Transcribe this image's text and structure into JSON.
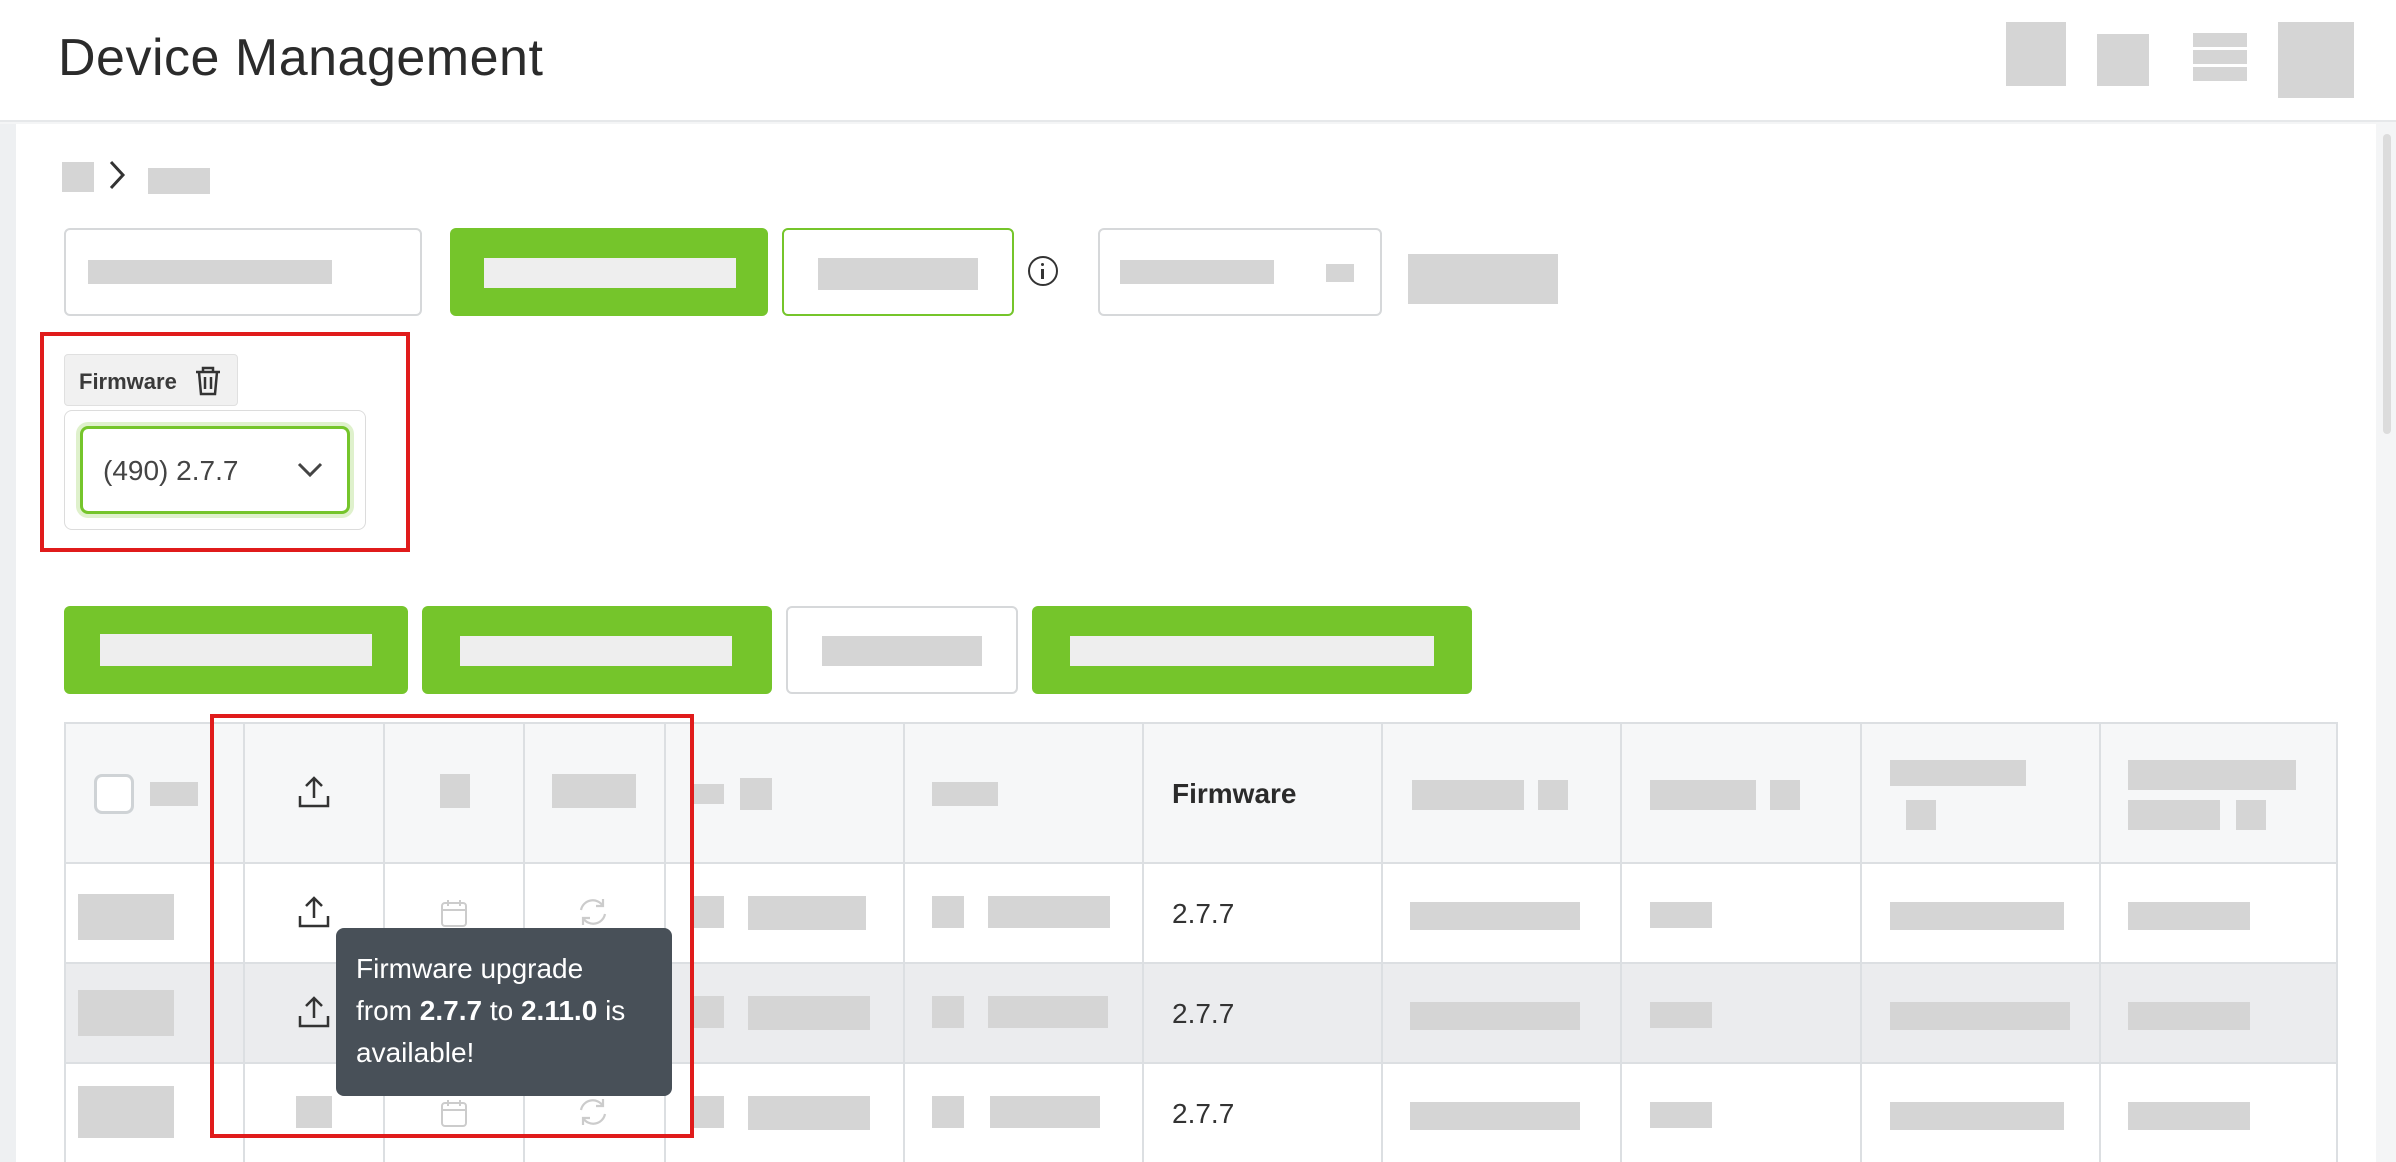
{
  "app": {
    "title": "Device Management"
  },
  "filter": {
    "tag_label": "Firmware",
    "firmware_select_value": "(490) 2.7.7"
  },
  "table": {
    "columns": {
      "firmware": "Firmware"
    },
    "rows": [
      {
        "firmware": "2.7.7"
      },
      {
        "firmware": "2.7.7"
      },
      {
        "firmware": "2.7.7"
      }
    ]
  },
  "tooltip": {
    "line1": "Firmware upgrade",
    "from_word": "from",
    "from_version": "2.7.7",
    "to_word": "to",
    "to_version": "2.11.0",
    "is_word": "is",
    "line3": "available!"
  },
  "icons": {
    "header": [
      "app-icon",
      "grid-icon",
      "menu-icon",
      "avatar"
    ],
    "breadcrumb": [
      "home-icon",
      "chevron-right-icon"
    ],
    "filter": [
      "info-icon",
      "trash-icon",
      "chevron-down-icon"
    ],
    "table": [
      "upload-icon",
      "calendar-icon",
      "refresh-icon"
    ]
  },
  "colors": {
    "accent_green": "#75c52b",
    "highlight_red": "#e01b1b",
    "tooltip_bg": "#485058"
  }
}
